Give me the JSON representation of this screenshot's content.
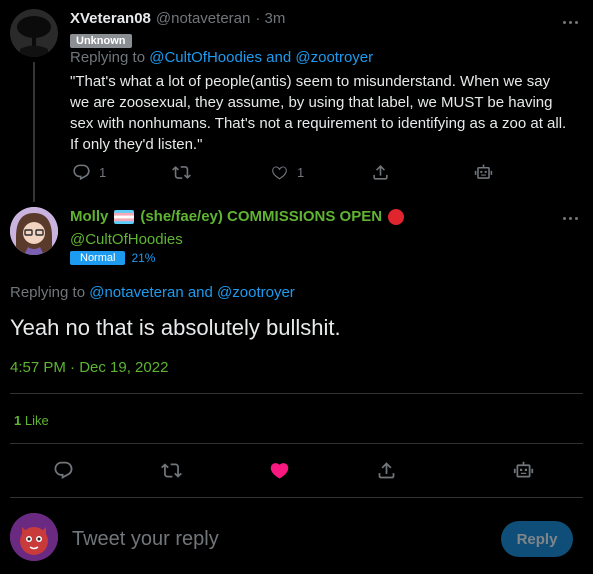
{
  "parent_tweet": {
    "display_name": "XVeteran08",
    "handle": "@notaveteran",
    "time": "· 3m",
    "badge": "Unknown",
    "replying_prefix": "Replying to",
    "replying_user1": "@CultOfHoodies",
    "replying_and": "and",
    "replying_user2": "@zootroyer",
    "text": "\"That's what a lot of people(antis) seem to misunderstand. When we say we are zoosexual, they assume, by using that label, we MUST be having sex with nonhumans. That's not a requirement to identifying as a zoo at all. If only they'd listen.\"",
    "reply_count": "1",
    "like_count": "1"
  },
  "main_tweet": {
    "display_name": "Molly",
    "pronouns": "(she/fae/ey) COMMISSIONS OPEN",
    "handle": "@CultOfHoodies",
    "badge": "Normal",
    "badge_percent": "21%",
    "replying_prefix": "Replying to",
    "replying_user1": "@notaveteran",
    "replying_and": "and",
    "replying_user2": "@zootroyer",
    "text": "Yeah no that is absolutely bullshit.",
    "timestamp": "4:57 PM · Dec 19, 2022",
    "likes_count": "1",
    "likes_label": "Like"
  },
  "reply_box": {
    "placeholder": "Tweet your reply",
    "button_label": "Reply"
  },
  "colors": {
    "accent": "#1d9bf0",
    "like_active": "#f91880",
    "green_name": "#5fb432",
    "unknown_badge": "#8b8f94"
  },
  "icons": [
    "more-icon",
    "reply-icon",
    "retweet-icon",
    "like-icon",
    "share-icon",
    "bot-icon",
    "trans-flag-icon",
    "red-circle-icon"
  ]
}
